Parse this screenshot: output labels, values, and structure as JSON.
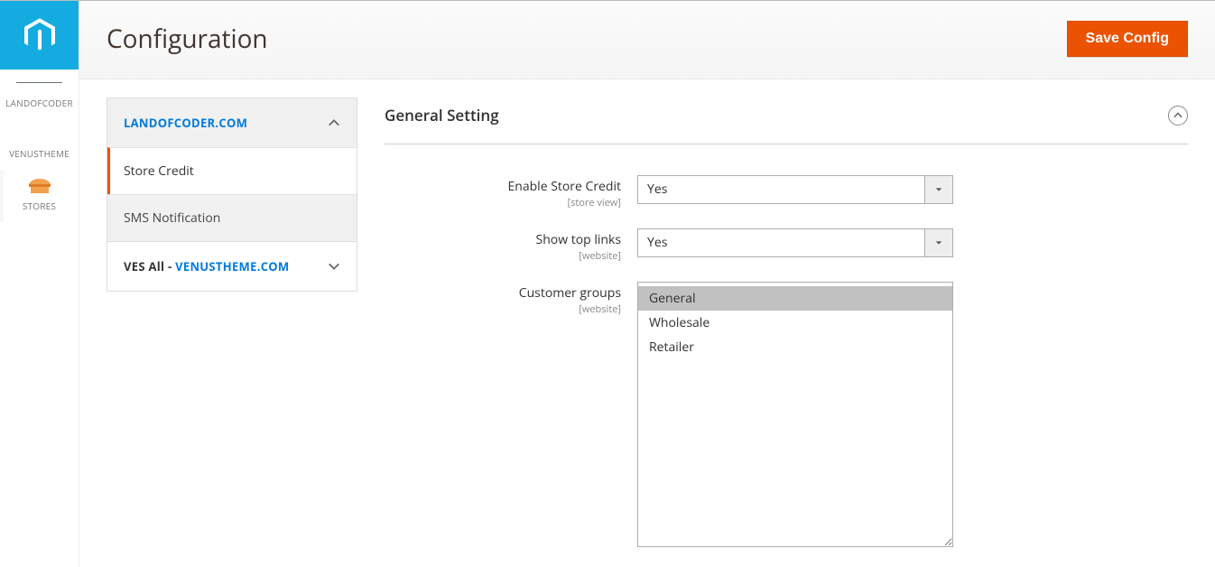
{
  "page": {
    "title": "Configuration",
    "save_label": "Save Config"
  },
  "sidebar": {
    "items": [
      {
        "label": "LANDOFCODER"
      },
      {
        "label": "VENUSTHEME"
      },
      {
        "label": "STORES"
      }
    ]
  },
  "config_nav": {
    "group1": {
      "title": "LANDOFCODER.COM",
      "items": [
        {
          "label": "Store Credit"
        },
        {
          "label": "SMS Notification"
        }
      ]
    },
    "group2": {
      "prefix": "VES All - ",
      "link": "VENUSTHEME.COM"
    }
  },
  "section": {
    "title": "General Setting"
  },
  "fields": {
    "enable": {
      "label": "Enable Store Credit",
      "scope": "[store view]",
      "value": "Yes"
    },
    "toplinks": {
      "label": "Show top links",
      "scope": "[website]",
      "value": "Yes"
    },
    "groups": {
      "label": "Customer groups",
      "scope": "[website]",
      "options": [
        {
          "label": "General",
          "selected": true
        },
        {
          "label": "Wholesale",
          "selected": false
        },
        {
          "label": "Retailer",
          "selected": false
        }
      ]
    }
  }
}
